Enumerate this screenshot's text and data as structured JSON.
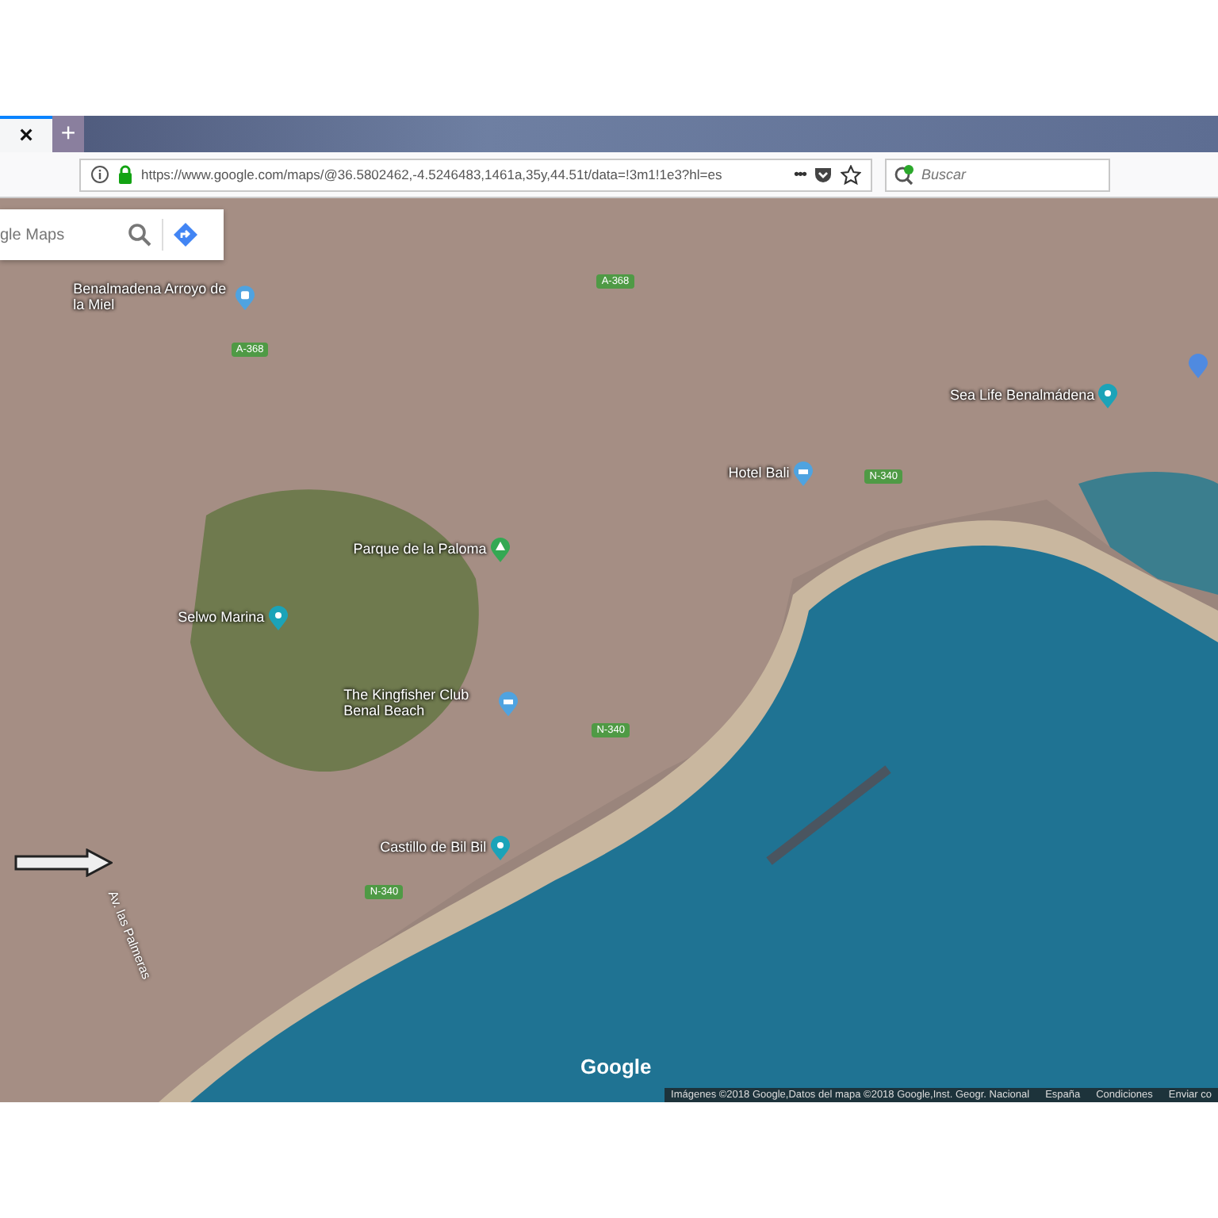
{
  "browser": {
    "tab": {
      "close": "×"
    },
    "new_tab": "+",
    "url": "https://www.google.com/maps/@36.5802462,-4.5246483,1461a,35y,44.51t/data=!3m1!1e3?hl=es",
    "menu": "•••",
    "search": {
      "placeholder": "Buscar"
    }
  },
  "map": {
    "search": {
      "placeholder": "gle Maps"
    },
    "places": [
      {
        "kind": "transit",
        "name": "Benalmadena Arroyo de la Miel",
        "color": "#4fa3e0"
      },
      {
        "kind": "park",
        "name": "Parque de la Paloma",
        "color": "#34a853"
      },
      {
        "kind": "place",
        "name": "Selwo Marina",
        "color": "#1ba3b8"
      },
      {
        "kind": "hotel",
        "name": "The Kingfisher Club Benal Beach",
        "color": "#4fa3e0"
      },
      {
        "kind": "place",
        "name": "Castillo de Bil Bil",
        "color": "#1ba3b8"
      },
      {
        "kind": "hotel",
        "name": "Hotel Bali",
        "color": "#4fa3e0"
      },
      {
        "kind": "place",
        "name": "Sea Life Benalmádena",
        "color": "#1ba3b8"
      }
    ],
    "roads": [
      "A-368",
      "A-368",
      "N-340",
      "N-340",
      "N-340"
    ],
    "street": "Av. las Palmeras",
    "logo": "Google",
    "footer": [
      "Imágenes ©2018 Google,Datos del mapa ©2018 Google,Inst. Geogr. Nacional",
      "España",
      "Condiciones",
      "Enviar co"
    ]
  }
}
